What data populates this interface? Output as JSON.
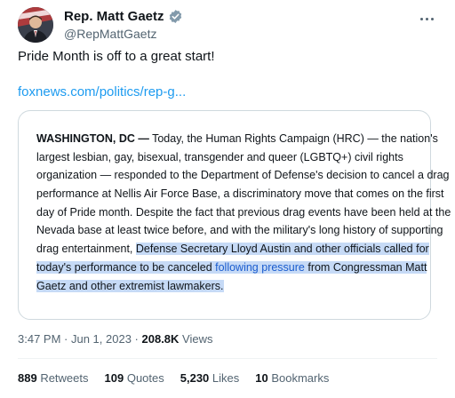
{
  "author": {
    "display_name": "Rep. Matt Gaetz",
    "handle": "@RepMattGaetz",
    "avatar_icon": "profile-photo-icon",
    "verified_icon": "verified-badge-icon",
    "verified_color": "#829aab"
  },
  "tweet": {
    "text": "Pride Month is off to a great start!",
    "link": "foxnews.com/politics/rep-g..."
  },
  "card": {
    "dateline": "WASHINGTON, DC —",
    "line1_rest": " Today, the Human Rights Campaign (HRC) — the nation's",
    "line2": "largest lesbian, gay, bisexual, transgender and queer (LGBTQ+) civil rights",
    "line3": "organization — responded to the Department of Defense's decision to cancel a drag",
    "line4": "performance at Nellis Air Force Base, a discriminatory move that comes on the first",
    "line5": "day of Pride month. Despite the fact that previous drag events have been held at the",
    "line6": "Nevada base at least twice before, and with the military's long history of supporting",
    "line7_plain": "drag entertainment, ",
    "line7_hl": "Defense Secretary Lloyd Austin and other officials called for",
    "line8_hl_a": "today's performance to be canceled ",
    "line8_link": "following pressure",
    "line8_hl_b": " from Congressman Matt",
    "line9_hl": "Gaetz and other extremist lawmakers.",
    "highlight_color": "#c6daf6"
  },
  "meta": {
    "time": "3:47 PM",
    "sep1": " · ",
    "date": "Jun 1, 2023",
    "sep2": " · ",
    "views_count": "208.8K",
    "views_label": " Views"
  },
  "stats": {
    "retweets_count": "889",
    "retweets_label": " Retweets",
    "quotes_count": "109",
    "quotes_label": " Quotes",
    "likes_count": "5,230",
    "likes_label": " Likes",
    "bookmarks_count": "10",
    "bookmarks_label": " Bookmarks"
  },
  "colors": {
    "link": "#1d9bf0",
    "secondary_text": "#536471",
    "border": "#cfd9de"
  }
}
